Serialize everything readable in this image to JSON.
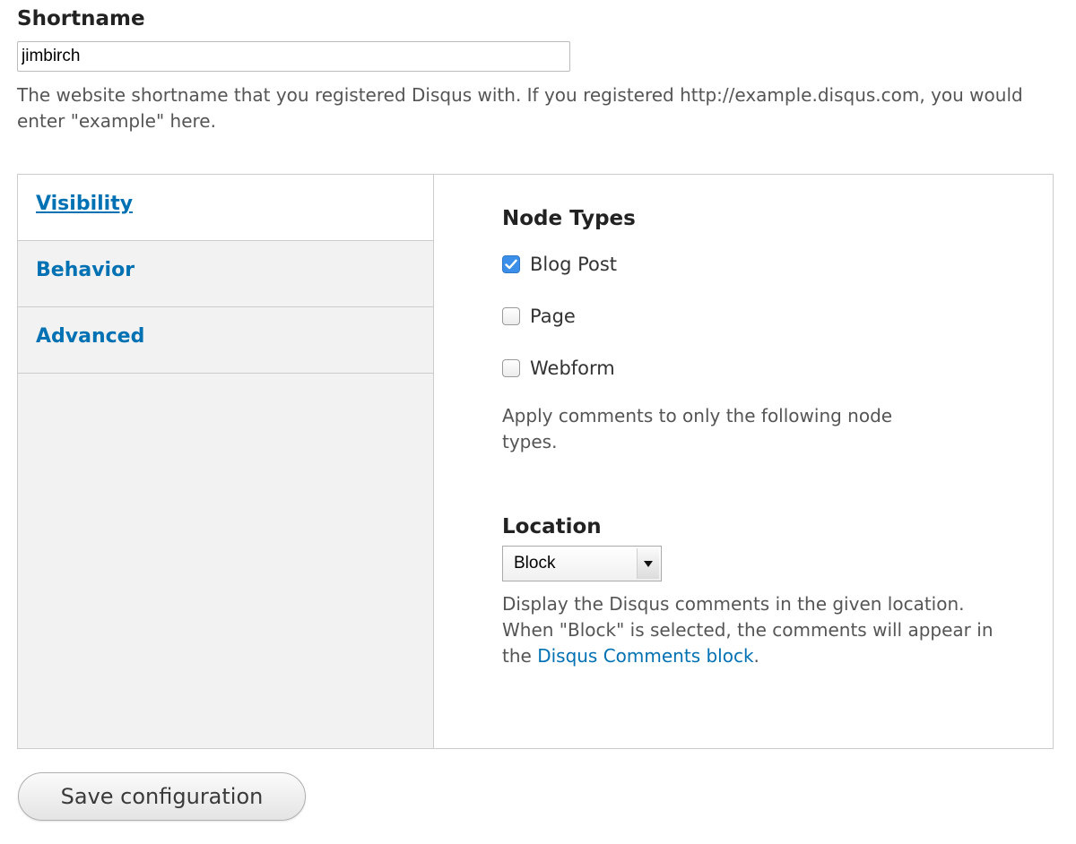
{
  "shortname": {
    "label": "Shortname",
    "value": "jimbirch",
    "description": "The website shortname that you registered Disqus with. If you registered http://example.disqus.com, you would enter \"example\" here."
  },
  "tabs": [
    {
      "label": "Visibility",
      "active": true
    },
    {
      "label": "Behavior",
      "active": false
    },
    {
      "label": "Advanced",
      "active": false
    }
  ],
  "visibility": {
    "node_types": {
      "title": "Node Types",
      "options": [
        {
          "label": "Blog Post",
          "checked": true
        },
        {
          "label": "Page",
          "checked": false
        },
        {
          "label": "Webform",
          "checked": false
        }
      ],
      "description": "Apply comments to only the following node types."
    },
    "location": {
      "title": "Location",
      "selected": "Block",
      "description_before": "Display the Disqus comments in the given location. When \"Block\" is selected, the comments will appear in the ",
      "description_link": "Disqus Comments block",
      "description_after": "."
    }
  },
  "actions": {
    "save_label": "Save configuration"
  },
  "colors": {
    "link": "#0071b3",
    "checkbox_checked": "#3b8fe8",
    "tab_menu_bg": "#f2f2f2"
  }
}
